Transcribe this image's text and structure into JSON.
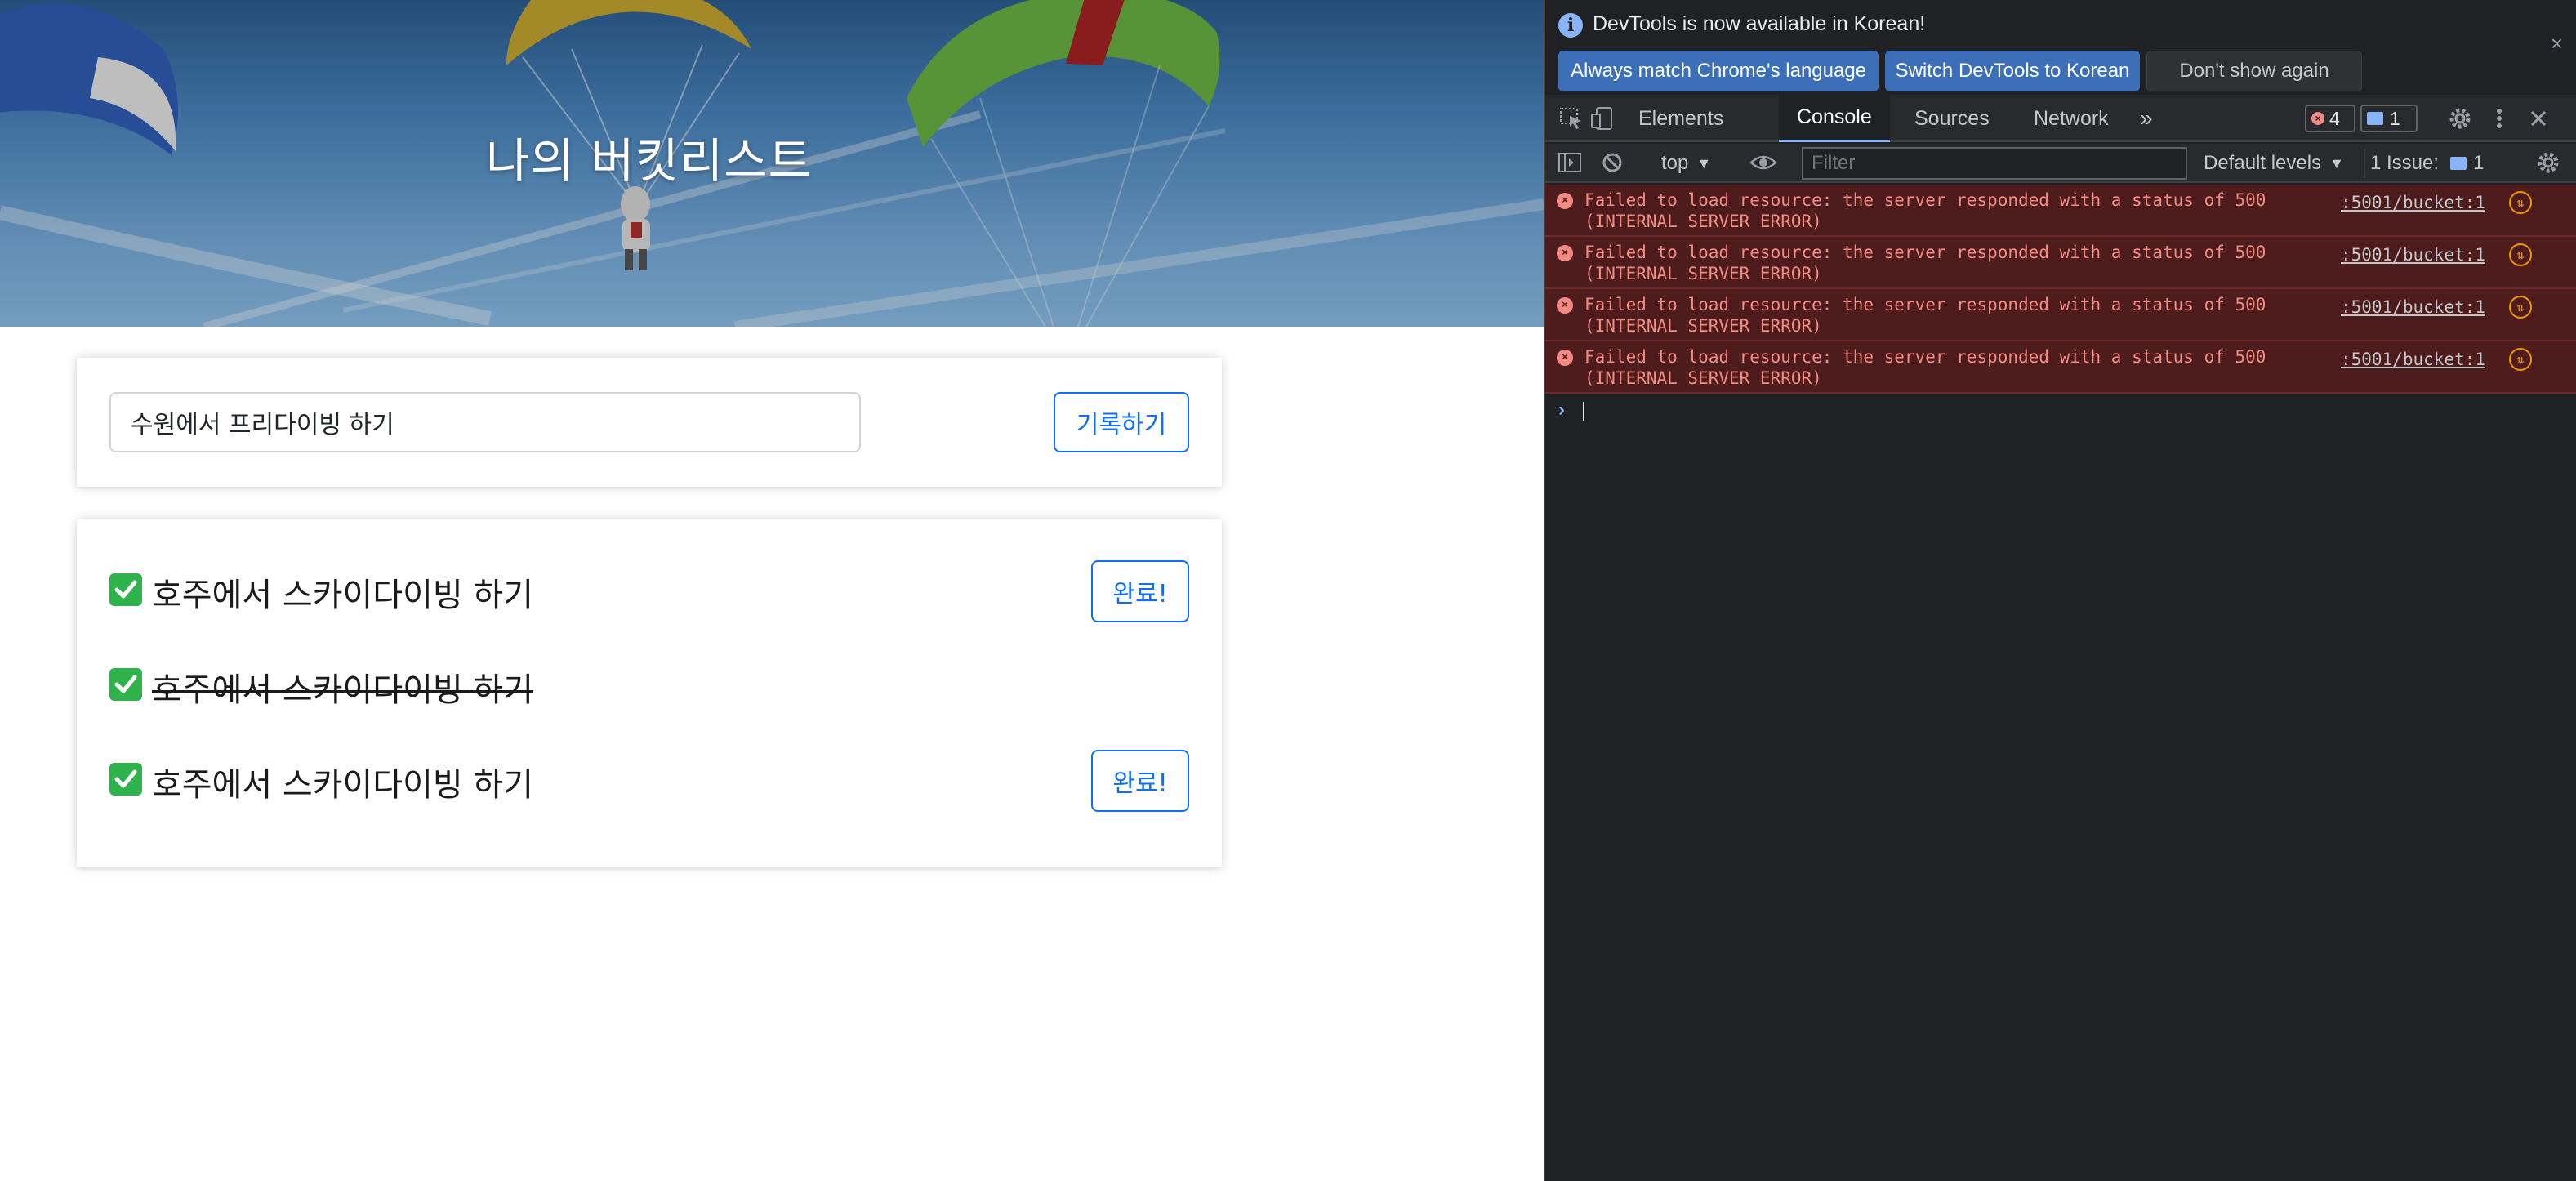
{
  "page": {
    "hero_title": "나의 버킷리스트",
    "input_value": "수원에서 프리다이빙 하기",
    "record_button_label": "기록하기",
    "items": [
      {
        "text": "호주에서 스카이다이빙 하기",
        "done": false,
        "button_label": "완료!"
      },
      {
        "text": "호주에서 스카이다이빙 하기",
        "done": true
      },
      {
        "text": "호주에서 스카이다이빙 하기",
        "done": false,
        "button_label": "완료!"
      }
    ]
  },
  "devtools": {
    "infobar": {
      "message": "DevTools is now available in Korean!",
      "btn_match": "Always match Chrome's language",
      "btn_switch": "Switch DevTools to Korean",
      "btn_dont": "Don't show again",
      "close": "×"
    },
    "tabs": {
      "elements": "Elements",
      "console": "Console",
      "sources": "Sources",
      "network": "Network",
      "more": "»"
    },
    "badges": {
      "errors": "4",
      "issues": "1"
    },
    "toolbar": {
      "context": "top",
      "filter_placeholder": "Filter",
      "levels": "Default levels",
      "issue_label": "1 Issue:",
      "issue_count": "1"
    },
    "messages": [
      {
        "text": "Failed to load resource: the server responded with a status of 500\n(INTERNAL SERVER ERROR)",
        "source": ":5001/bucket:1"
      },
      {
        "text": "Failed to load resource: the server responded with a status of 500\n(INTERNAL SERVER ERROR)",
        "source": ":5001/bucket:1"
      },
      {
        "text": "Failed to load resource: the server responded with a status of 500\n(INTERNAL SERVER ERROR)",
        "source": ":5001/bucket:1"
      },
      {
        "text": "Failed to load resource: the server responded with a status of 500\n(INTERNAL SERVER ERROR)",
        "source": ":5001/bucket:1"
      }
    ]
  },
  "colors": {
    "primary": "#0d6efd",
    "check_green": "#2fb24c",
    "devtools_bg": "#202124",
    "error_bg": "#4e1c1c",
    "error_text": "#f28b82"
  }
}
